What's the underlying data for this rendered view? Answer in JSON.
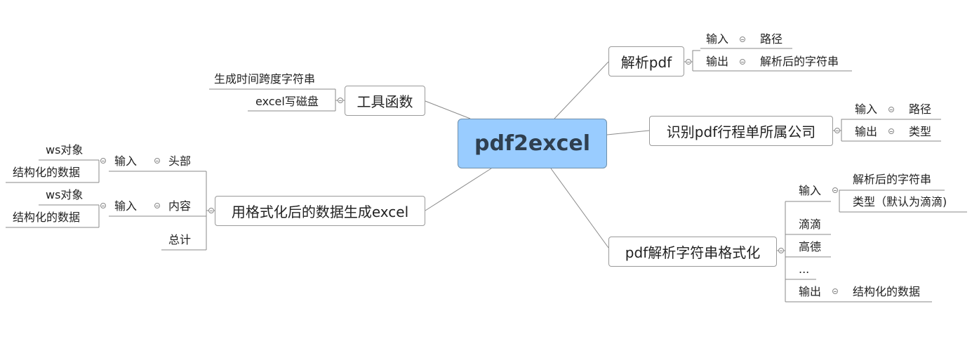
{
  "central": "pdf2excel",
  "right": {
    "parse_pdf": {
      "label": "解析pdf",
      "input": {
        "label": "输入",
        "value": "路径"
      },
      "output": {
        "label": "输出",
        "value": "解析后的字符串"
      }
    },
    "identify": {
      "label": "识别pdf行程单所属公司",
      "input": {
        "label": "输入",
        "value": "路径"
      },
      "output": {
        "label": "输出",
        "value": "类型"
      }
    },
    "format": {
      "label": "pdf解析字符串格式化",
      "input": {
        "label": "输入",
        "values": [
          "解析后的字符串",
          "类型（默认为滴滴)"
        ]
      },
      "items": [
        "滴滴",
        "高德",
        "..."
      ],
      "output": {
        "label": "输出",
        "value": "结构化的数据"
      }
    }
  },
  "left": {
    "tools": {
      "label": "工具函数",
      "items": [
        "生成时间跨度字符串",
        "excel写磁盘"
      ]
    },
    "generate": {
      "label": "用格式化后的数据生成excel",
      "header": {
        "label": "头部",
        "input": "输入",
        "values": [
          "ws对象",
          "结构化的数据"
        ]
      },
      "content": {
        "label": "内容",
        "input": "输入",
        "values": [
          "ws对象",
          "结构化的数据"
        ]
      },
      "total": "总计"
    }
  }
}
